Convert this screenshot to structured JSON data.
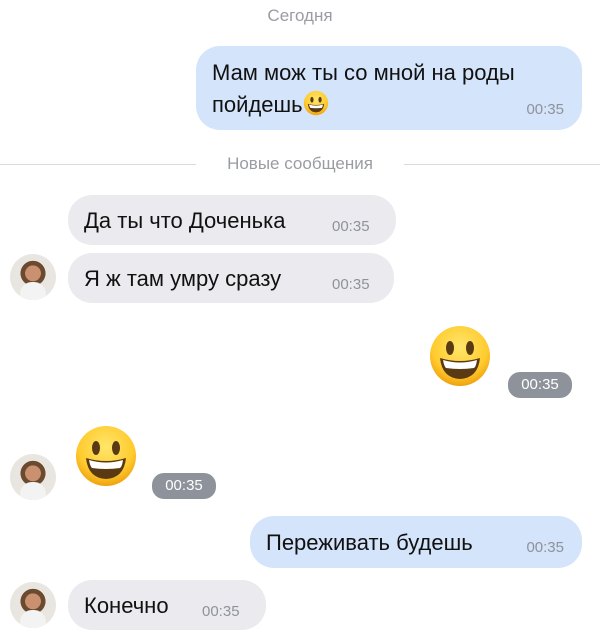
{
  "header": {
    "date_label": "Сегодня",
    "new_messages_label": "Новые сообщения"
  },
  "messages": [
    {
      "direction": "outgoing",
      "text_line1": "Мам мож ты со мной на роды",
      "text_line2": "пойдешь",
      "emoji": "grinning-face",
      "time": "00:35"
    },
    {
      "direction": "incoming",
      "text": "Да ты что Доченька",
      "time": "00:35"
    },
    {
      "direction": "incoming",
      "text": "Я ж там умру сразу",
      "time": "00:35"
    },
    {
      "direction": "outgoing",
      "emoji": "grinning-face",
      "time": "00:35"
    },
    {
      "direction": "incoming",
      "emoji": "grinning-face",
      "time": "00:35"
    },
    {
      "direction": "outgoing",
      "text": "Переживать будешь",
      "time": "00:35"
    },
    {
      "direction": "incoming",
      "text": "Конечно",
      "time": "00:35"
    }
  ],
  "colors": {
    "outgoing_bubble": "#d4e4fb",
    "incoming_bubble": "#ebebef",
    "meta_text": "#9a9ca3"
  }
}
